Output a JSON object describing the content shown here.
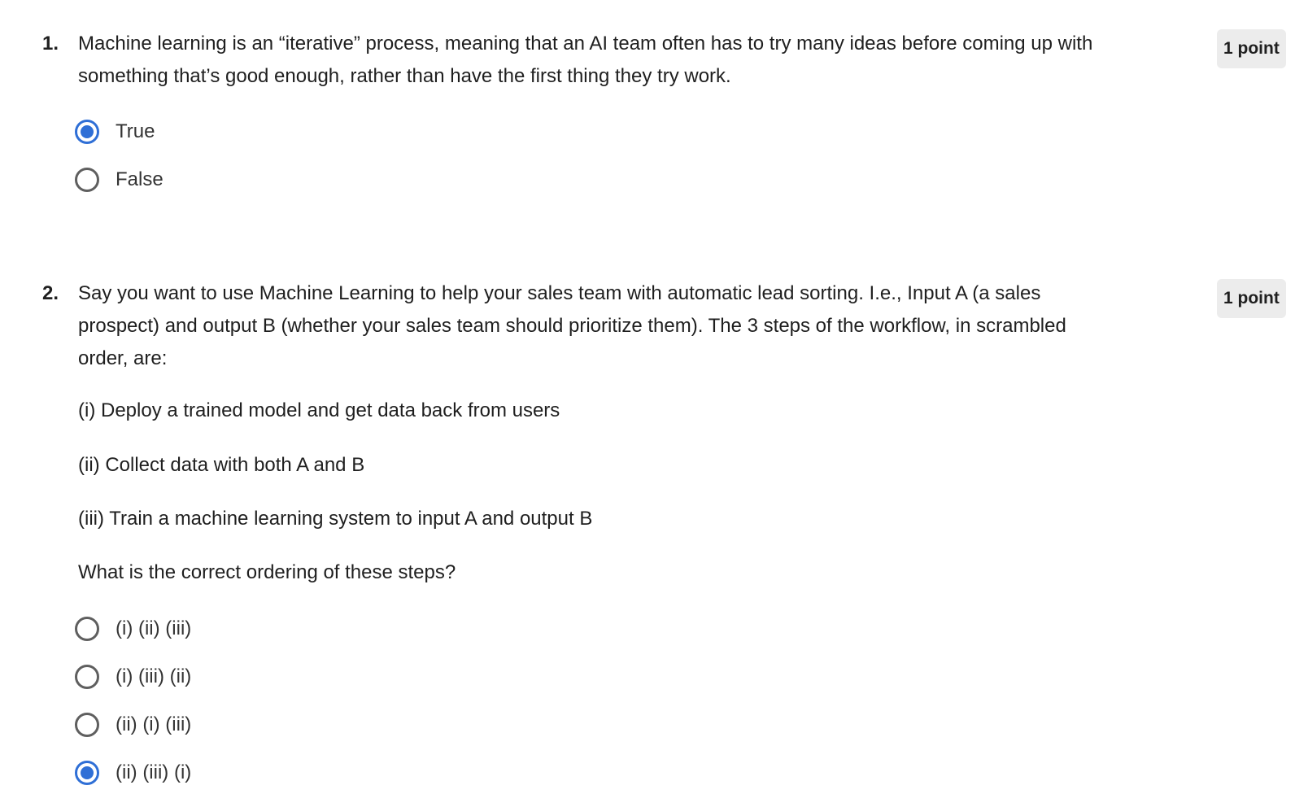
{
  "questions": [
    {
      "number": "1.",
      "text": "Machine learning is an “iterative” process, meaning that an AI team often has to try many ideas before coming up with something that’s good enough, rather than have the first thing they try work.",
      "points": "1 point",
      "options": [
        {
          "label": "True",
          "selected": true
        },
        {
          "label": "False",
          "selected": false
        }
      ]
    },
    {
      "number": "2.",
      "text": "Say you want to use Machine Learning to help your sales team with automatic lead sorting. I.e., Input A (a sales prospect) and output B (whether your sales team should prioritize them). The 3 steps of the workflow, in scrambled order, are:",
      "points": "1 point",
      "steps": [
        "(i) Deploy a trained model and get data back from users",
        "(ii) Collect data with both A and B",
        "(iii) Train a machine learning system to input A and output B"
      ],
      "prompt": "What is the correct ordering of these steps?",
      "options": [
        {
          "label": "(i) (ii) (iii)",
          "selected": false
        },
        {
          "label": "(i) (iii) (ii)",
          "selected": false
        },
        {
          "label": "(ii) (i) (iii)",
          "selected": false
        },
        {
          "label": "(ii) (iii) (i)",
          "selected": true
        }
      ]
    }
  ],
  "colors": {
    "accent": "#2f6fd6",
    "badge_bg": "#ececec",
    "text": "#1f1f1f"
  }
}
